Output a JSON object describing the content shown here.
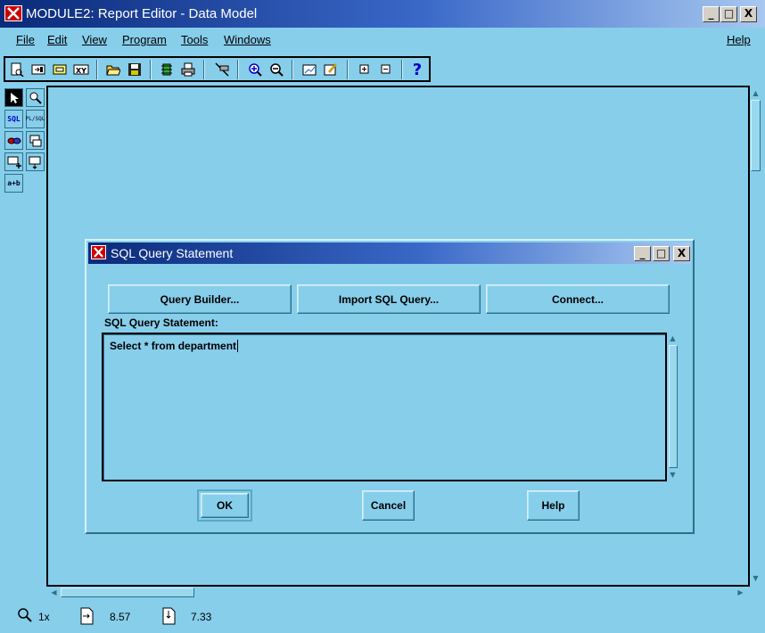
{
  "window": {
    "title": "MODULE2: Report Editor - Data Model",
    "minimize": "_",
    "maximize": "□",
    "close": "X"
  },
  "menu": [
    {
      "label": "File"
    },
    {
      "label": "Edit"
    },
    {
      "label": "View"
    },
    {
      "label": "Program"
    },
    {
      "label": "Tools"
    },
    {
      "label": "Windows"
    },
    {
      "label": "Help"
    }
  ],
  "toolbar": {
    "icons": [
      "new-report-icon",
      "open-icon",
      "save-as-icon",
      "xy-icon",
      "open-folder-icon",
      "save-icon",
      "run-icon",
      "print-icon",
      "link-icon",
      "zoom-in-icon",
      "zoom-out-icon",
      "edit-chart-icon",
      "edit-pencil-icon",
      "expand-icon",
      "collapse-icon",
      "help-icon"
    ],
    "help_glyph": "?"
  },
  "palette": {
    "sql_label": "SQL",
    "plsql_label": "PL/SQL",
    "ref_label": "a+b"
  },
  "status": {
    "zoom": "1x",
    "x_value": "8.57",
    "y_value": "7.33"
  },
  "dialog": {
    "title": "SQL Query Statement",
    "buttons": {
      "query_builder": "Query Builder...",
      "import_sql": "Import SQL Query...",
      "connect": "Connect...",
      "ok": "OK",
      "cancel": "Cancel",
      "help": "Help"
    },
    "sql_label": "SQL Query Statement:",
    "sql_text": "Select * from department"
  },
  "colors": {
    "background": "#87ceeb",
    "title_start": "#0a2a7a",
    "title_end": "#a8c8f0"
  }
}
